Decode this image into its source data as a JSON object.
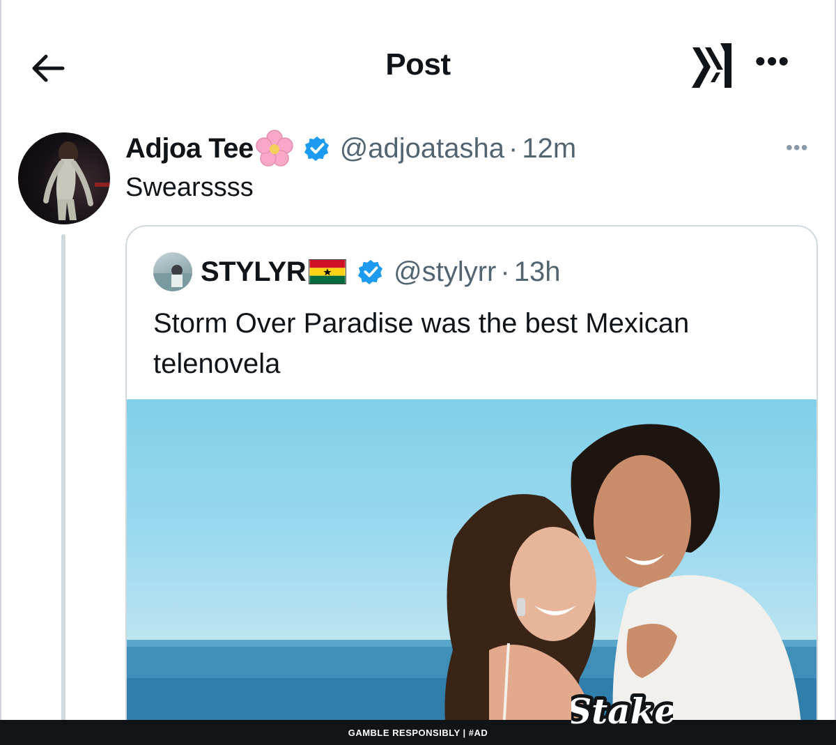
{
  "header": {
    "title": "Post"
  },
  "post": {
    "author_name": "Adjoa Tee",
    "handle": "@adjoatasha",
    "separator": "·",
    "time": "12m",
    "text": "Swearssss"
  },
  "quote": {
    "author_name": "STYLYR",
    "handle": "@stylyrr",
    "separator": "·",
    "time": "13h",
    "text": "Storm Over Paradise was the best Mexican telenovela"
  },
  "ad": {
    "text": "GAMBLE RESPONSIBLY  |  #AD",
    "logo_text": "Stake"
  },
  "colors": {
    "verified": "#1d9bf0",
    "secondary_text": "#536471",
    "ad_bar": "#111417"
  }
}
